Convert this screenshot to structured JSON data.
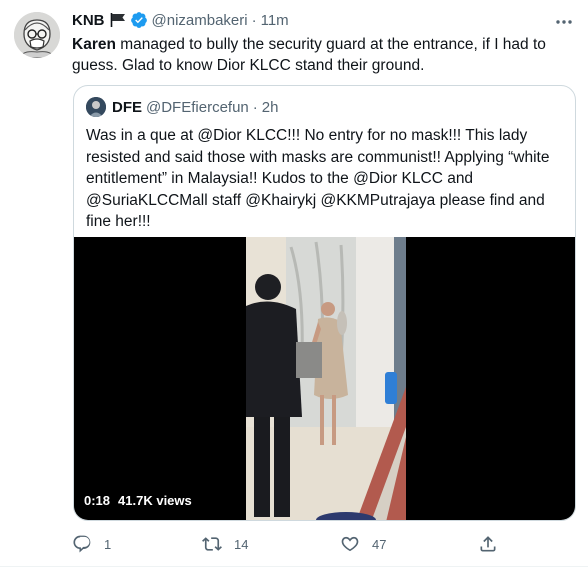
{
  "tweet": {
    "display_name": "KNB",
    "handle": "@nizambakeri",
    "separator": "·",
    "time": "11m",
    "text_bold": "Karen",
    "text_rest": " managed to bully the security guard at the entrance, if I had to guess. Glad to know Dior KLCC stand their ground."
  },
  "quote": {
    "display_name": "DFE",
    "handle": "@DFEfiercefun",
    "separator": "·",
    "time": "2h",
    "text": "Was in a que at @Dior KLCC!!! No entry for no mask!!! This lady resisted and said those with masks are communist!! Applying  “white entitlement” in Malaysia!! Kudos to the @Dior KLCC and @SuriaKLCCMall staff @Khairykj @KKMPutrajaya please find and fine her!!!"
  },
  "video": {
    "duration": "0:18",
    "views": "41.7K views"
  },
  "actions": {
    "reply_count": "1",
    "retweet_count": "14",
    "like_count": "47"
  },
  "colors": {
    "text": "#0f1419",
    "secondary": "#536471",
    "verified": "#1d9bf0",
    "border": "#cfd9de"
  }
}
